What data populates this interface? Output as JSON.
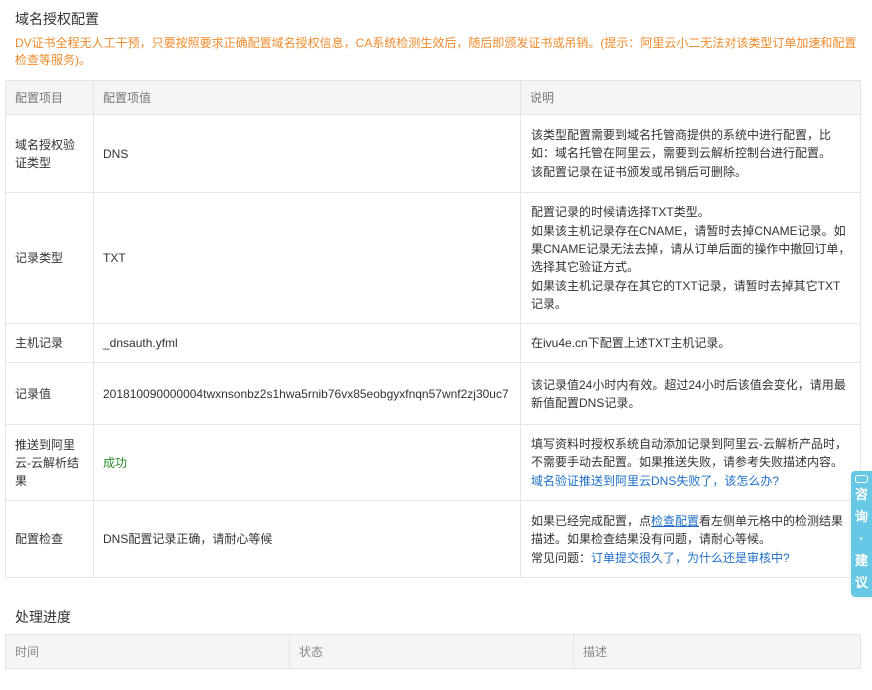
{
  "section1_title": "域名授权配置",
  "notice": "DV证书全程无人工干预，只要按照要求正确配置域名授权信息，CA系统检测生效后，随后即颁发证书或吊销。(提示：阿里云小二无法对该类型订单加速和配置检查等服务)。",
  "config_table": {
    "headers": [
      "配置项目",
      "配置项值",
      "说明"
    ],
    "rows": [
      {
        "item": "域名授权验证类型",
        "value": "DNS",
        "desc": [
          "该类型配置需要到域名托管商提供的系统中进行配置，比如：域名托管在阿里云，需要到云解析控制台进行配置。",
          "该配置记录在证书颁发或吊销后可删除。"
        ]
      },
      {
        "item": "记录类型",
        "value": "TXT",
        "desc": [
          "配置记录的时候请选择TXT类型。",
          "如果该主机记录存在CNAME，请暂时去掉CNAME记录。如果CNAME记录无法去掉，请从订单后面的操作中撤回订单，选择其它验证方式。",
          "如果该主机记录存在其它的TXT记录，请暂时去掉其它TXT记录。"
        ]
      },
      {
        "item": "主机记录",
        "value": "_dnsauth.yfml",
        "desc": [
          "在ivu4e.cn下配置上述TXT主机记录。"
        ]
      },
      {
        "item": "记录值",
        "value": "201810090000004twxnsonbz2s1hwa5rnib76vx85eobgyxfnqn57wnf2zj30uc7",
        "desc": [
          "该记录值24小时内有效。超过24小时后该值会变化，请用最新值配置DNS记录。"
        ]
      },
      {
        "item": "推送到阿里云-云解析结果",
        "value": "成功",
        "desc": [
          "填写资料时授权系统自动添加记录到阿里云-云解析产品时，不需要手动去配置。如果推送失败，请参考失败描述内容。"
        ],
        "link": "域名验证推送到阿里云DNS失败了，该怎么办?"
      },
      {
        "item": "配置检查",
        "value": "DNS配置记录正确，请耐心等候",
        "desc_a": "如果已经完成配置，点",
        "desc_link": "检查配置",
        "desc_b": "看左侧单元格中的检测结果描述。如果检查结果没有问题，请耐心等候。",
        "faq_label": "常见问题：",
        "faq_link": "订单提交很久了，为什么还是审核中?"
      }
    ]
  },
  "section2_title": "处理进度",
  "progress_table": {
    "headers": [
      "时间",
      "状态",
      "描述"
    ]
  },
  "float_button": {
    "chars": [
      "咨",
      "询",
      "·",
      "建",
      "议"
    ],
    "icon": "chat-bubble-icon"
  }
}
